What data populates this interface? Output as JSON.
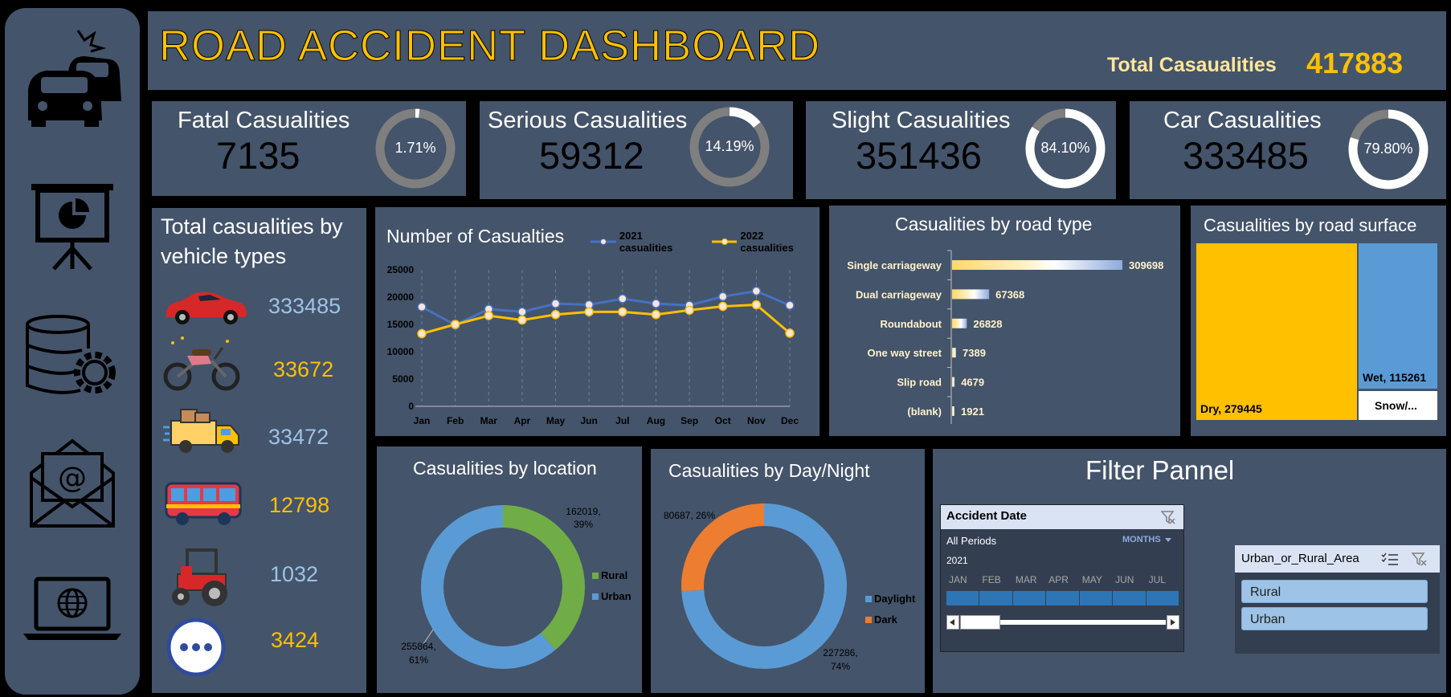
{
  "header": {
    "title": "ROAD ACCIDENT DASHBOARD",
    "total_label": "Total Casaualities",
    "total_value": "417883"
  },
  "sidebar": {
    "icons": [
      "car-crash-icon",
      "presentation-chart-icon",
      "database-settings-icon",
      "email-icon",
      "laptop-globe-icon"
    ]
  },
  "kpis": [
    {
      "title": "Fatal Casualities",
      "value": "7135",
      "pct_label": "1.71%",
      "pct": 1.71
    },
    {
      "title": "Serious Casualities",
      "value": "59312",
      "pct_label": "14.19%",
      "pct": 14.19
    },
    {
      "title": "Slight Casualities",
      "value": "351436",
      "pct_label": "84.10%",
      "pct": 84.1
    },
    {
      "title": "Car Casualities",
      "value": "333485",
      "pct_label": "79.80%",
      "pct": 79.8
    }
  ],
  "vehicles": {
    "title_line1": "Total casualities by",
    "title_line2": "vehicle types",
    "items": [
      {
        "icon": "car-icon",
        "value": "333485",
        "color": "#9dc3e6"
      },
      {
        "icon": "motorcycle-icon",
        "value": "33672",
        "color": "#ffc000"
      },
      {
        "icon": "truck-icon",
        "value": "33472",
        "color": "#9dc3e6"
      },
      {
        "icon": "bus-icon",
        "value": "12798",
        "color": "#ffc000"
      },
      {
        "icon": "tractor-icon",
        "value": "1032",
        "color": "#9dc3e6"
      },
      {
        "icon": "more-icon",
        "value": "3424",
        "color": "#ffc000"
      }
    ]
  },
  "chart_data": [
    {
      "type": "line",
      "title": "Number of Casualties",
      "categories": [
        "Jan",
        "Feb",
        "Mar",
        "Apr",
        "May",
        "Jun",
        "Jul",
        "Aug",
        "Sep",
        "Oct",
        "Nov",
        "Dec"
      ],
      "series": [
        {
          "name": "2021 casualities",
          "color": "#4472c4",
          "values": [
            18200,
            14900,
            17800,
            17300,
            18800,
            18600,
            19700,
            18800,
            18500,
            20100,
            21100,
            18500
          ]
        },
        {
          "name": "2022 casualities",
          "color": "#ffc000",
          "values": [
            13300,
            15000,
            16600,
            15800,
            16800,
            17300,
            17300,
            16800,
            17600,
            18300,
            18600,
            13400
          ]
        }
      ],
      "ylim": [
        0,
        25000
      ],
      "yticks": [
        0,
        5000,
        10000,
        15000,
        20000,
        25000
      ]
    },
    {
      "type": "bar",
      "title": "Casualities by road type",
      "categories": [
        "Single carriageway",
        "Dual carriageway",
        "Roundabout",
        "One way street",
        "Slip road",
        "(blank)"
      ],
      "values": [
        309698,
        67368,
        26828,
        7389,
        4679,
        1921
      ]
    },
    {
      "type": "treemap",
      "title": "Casualities by road surface",
      "items": [
        {
          "label": "Dry, 279445",
          "value": 279445,
          "color": "#ffc000"
        },
        {
          "label": "Wet, 115261",
          "value": 115261,
          "color": "#5b9bd5"
        },
        {
          "label": "Snow/...",
          "value": 23177,
          "color": "#ffffff"
        }
      ]
    },
    {
      "type": "pie",
      "title": "Casualities by location",
      "slices": [
        {
          "name": "Rural",
          "value": 162019,
          "pct": 39,
          "label": "162019,",
          "label2": "39%",
          "color": "#70ad47"
        },
        {
          "name": "Urban",
          "value": 255864,
          "pct": 61,
          "label": "255864,",
          "label2": "61%",
          "color": "#5b9bd5"
        }
      ]
    },
    {
      "type": "pie",
      "title": "Casualities by Day/Night",
      "slices": [
        {
          "name": "Daylight",
          "value": 227286,
          "pct": 74,
          "label": "227286,",
          "label2": "74%",
          "color": "#5b9bd5"
        },
        {
          "name": "Dark",
          "value": 80687,
          "pct": 26,
          "label": "80687, 26%",
          "label2": "",
          "color": "#ed7d31"
        }
      ]
    }
  ],
  "filter": {
    "title": "Filter Pannel",
    "date_slicer": {
      "title": "Accident Date",
      "period": "All Periods",
      "granularity": "MONTHS",
      "year": "2021",
      "months": [
        "JAN",
        "FEB",
        "MAR",
        "APR",
        "MAY",
        "JUN",
        "JUL"
      ]
    },
    "area_slicer": {
      "title": "Urban_or_Rural_Area",
      "items": [
        "Rural",
        "Urban"
      ]
    }
  }
}
